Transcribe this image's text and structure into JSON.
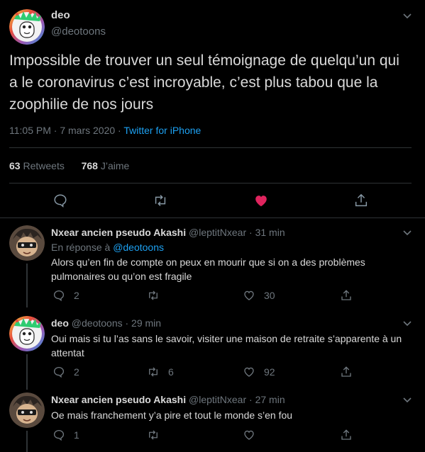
{
  "main": {
    "name": "deo",
    "handle": "@deotoons",
    "text": "Impossible de trouver un seul témoignage de quelqu’un qui a le coronavirus c’est incroyable, c’est plus tabou que la zoophilie de nos jours",
    "time": "11:05 PM · 7 mars 2020",
    "dot": " · ",
    "source": "Twitter for iPhone",
    "retweets_count": "63",
    "retweets_label": "Retweets",
    "likes_count": "768",
    "likes_label": "J’aime",
    "liked": true
  },
  "replies": [
    {
      "name": "Nxear ancien pseudo Akashi",
      "handle": "@leptitNxear",
      "time": "· 31 min",
      "reply_to_label": "En réponse à",
      "reply_to_handle": "@deotoons",
      "text": "Alors qu’en fin de compte on peux en mourir que si on a des problèmes pulmonaires ou qu’on est fragile",
      "replies": "2",
      "retweets": "",
      "likes": "30"
    },
    {
      "name": "deo",
      "handle": "@deotoons",
      "time": "· 29 min",
      "text": "Oui mais si tu l’as sans le savoir, visiter une maison de retraite s’apparente à un attentat",
      "replies": "2",
      "retweets": "6",
      "likes": "92"
    },
    {
      "name": "Nxear ancien pseudo Akashi",
      "handle": "@leptitNxear",
      "time": "· 27 min",
      "text": "Oe mais franchement y’a pire et tout le monde s’en fou",
      "replies": "1",
      "retweets": "",
      "likes": ""
    }
  ],
  "colors": {
    "background": "#000000",
    "text": "#d9d9d9",
    "muted": "#6e767d",
    "link": "#1da1f2",
    "like": "#e0245e",
    "border": "#2f3336"
  },
  "icons": [
    "chevron-down-icon",
    "reply-icon",
    "retweet-icon",
    "heart-icon",
    "share-icon"
  ]
}
